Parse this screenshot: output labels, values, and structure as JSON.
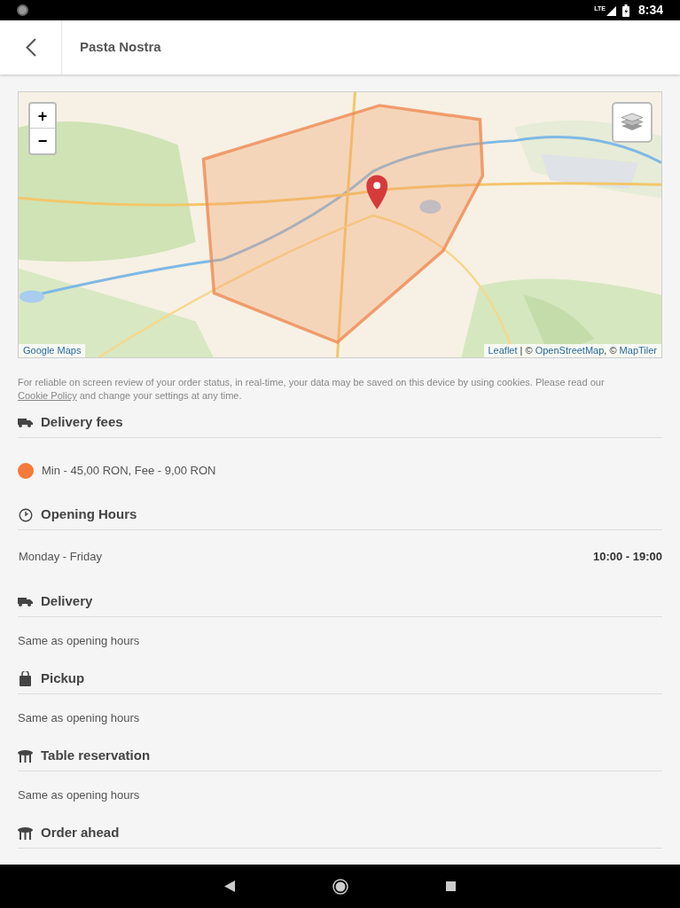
{
  "status_bar": {
    "network": "LTE",
    "time": "8:34"
  },
  "header": {
    "title": "Pasta Nostra"
  },
  "map": {
    "zoom_in": "+",
    "zoom_out": "−",
    "credit": "Google Maps",
    "attribution": [
      {
        "text": "Leaflet",
        "link": true
      },
      {
        "text": " | © ",
        "link": false
      },
      {
        "text": "OpenStreetMap",
        "link": true
      },
      {
        "text": ", © ",
        "link": false
      },
      {
        "text": "MapTiler",
        "link": true
      }
    ]
  },
  "cookie_notice": {
    "before": "For reliable on screen review of your order status, in real-time, your data may be saved on this device by using cookies. Please read our ",
    "link": "Cookie Policy",
    "after": " and change your settings at any time."
  },
  "sections": [
    {
      "title": "Delivery fees",
      "kind": "fees",
      "items": [
        {
          "color": "#f47a3c",
          "label": "Min - 45,00 RON, Fee - 9,00 RON"
        }
      ]
    },
    {
      "title": "Opening Hours",
      "kind": "hours",
      "rows": [
        {
          "days": "Monday - Friday",
          "hours": "10:00 - 19:00"
        }
      ]
    },
    {
      "title": "Delivery",
      "kind": "delivery",
      "text": "Same as opening hours"
    },
    {
      "title": "Pickup",
      "kind": "pickup",
      "text": "Same as opening hours"
    },
    {
      "title": "Table reservation",
      "kind": "reservation",
      "text": "Same as opening hours"
    },
    {
      "title": "Order ahead",
      "kind": "order_ahead"
    }
  ]
}
